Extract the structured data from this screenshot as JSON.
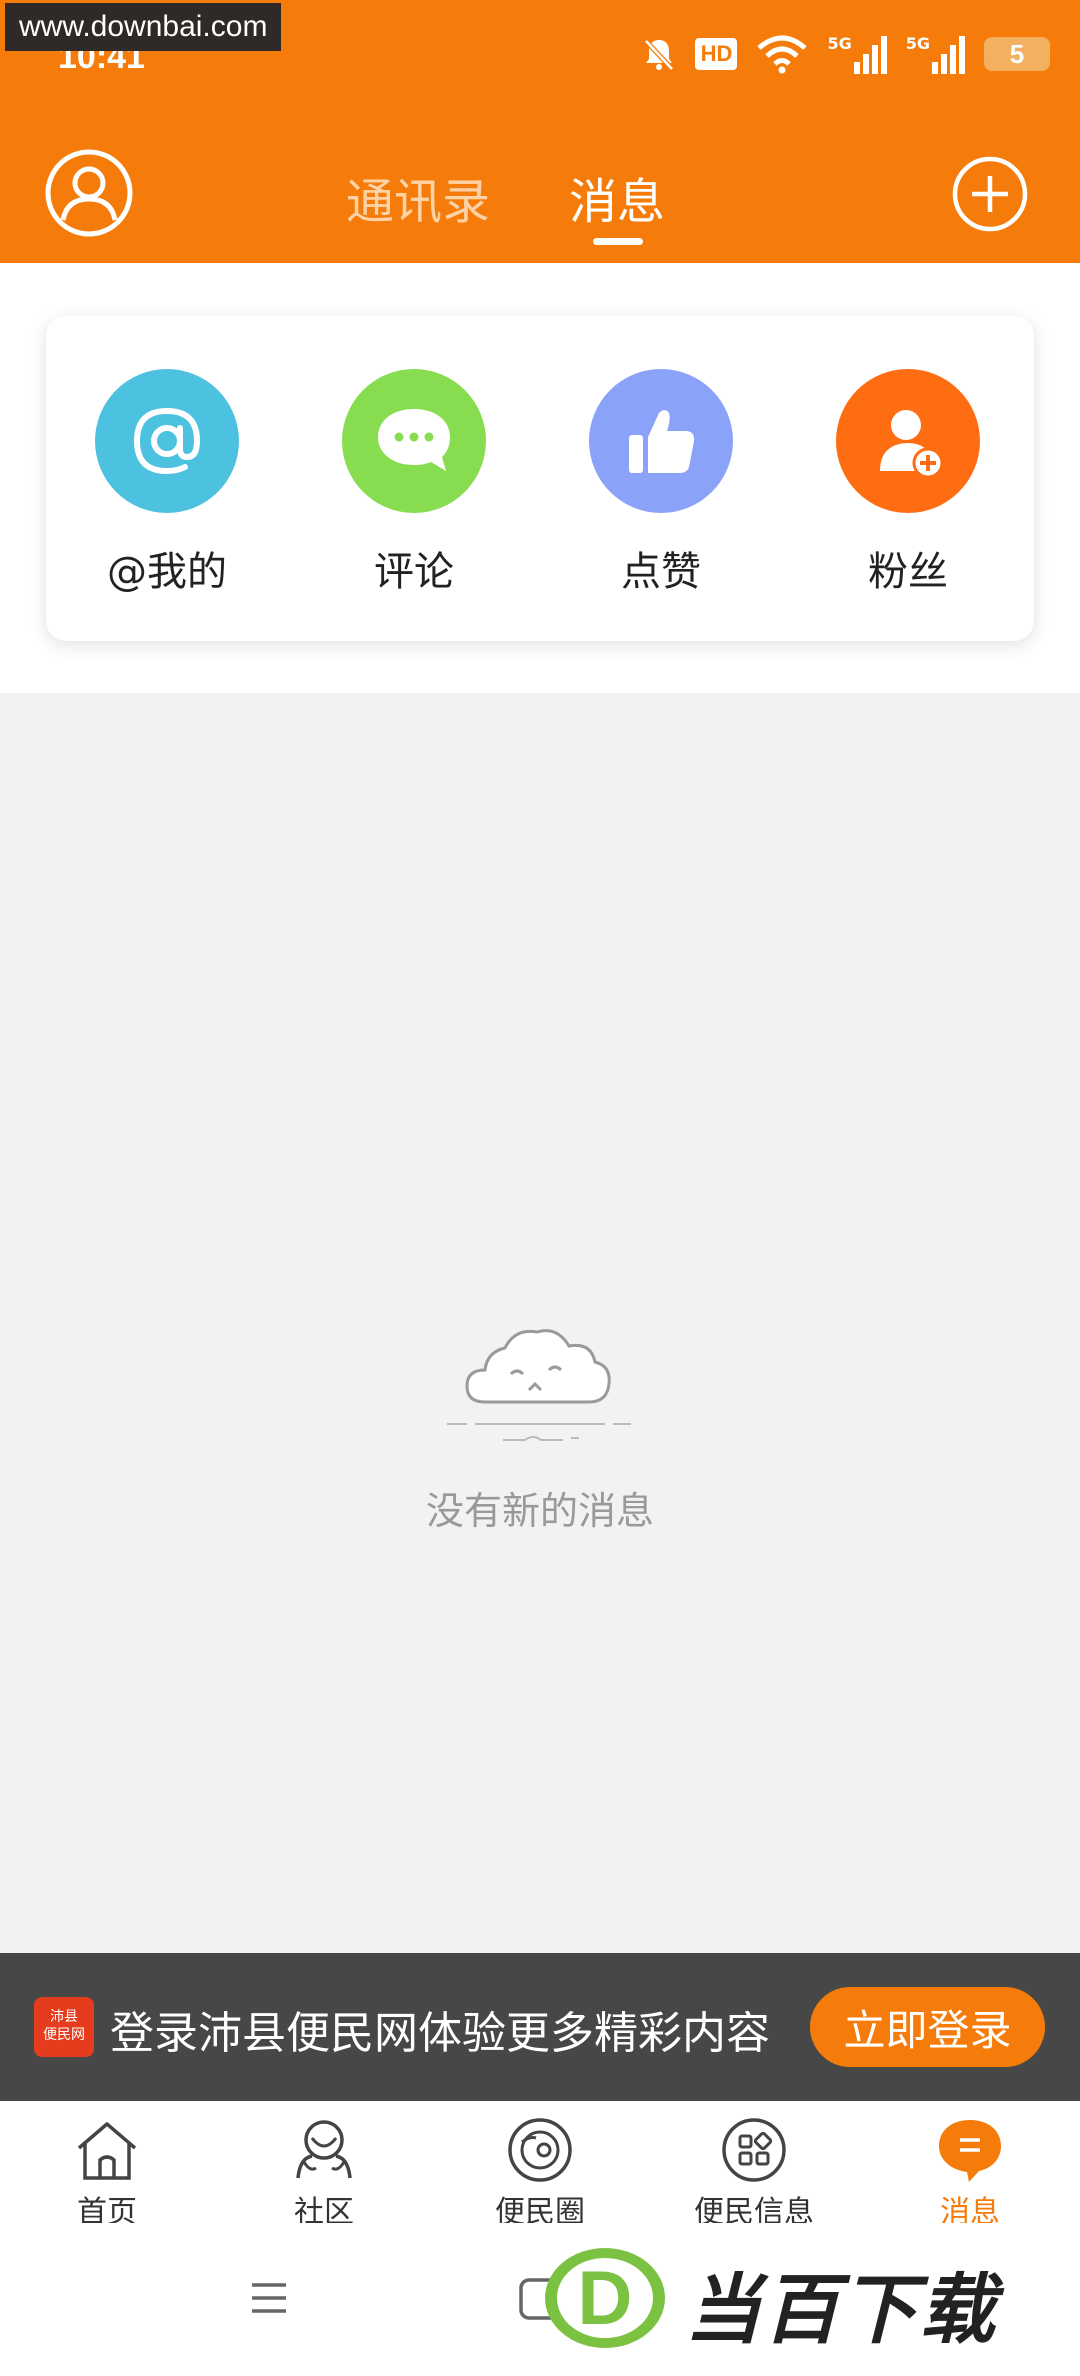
{
  "status_bar": {
    "watermark": "www.downbai.com",
    "time": "10:41",
    "hd_label": "HD",
    "network_1": "5G",
    "network_2": "5G",
    "battery": "5"
  },
  "header": {
    "tabs": [
      {
        "label": "通讯录",
        "active": false
      },
      {
        "label": "消息",
        "active": true
      }
    ]
  },
  "shortcuts": [
    {
      "label": "@我的",
      "icon": "at-icon",
      "color": "#4dc1e0"
    },
    {
      "label": "评论",
      "icon": "comment-icon",
      "color": "#87dd4f"
    },
    {
      "label": "点赞",
      "icon": "thumbs-up-icon",
      "color": "#8ba2f9"
    },
    {
      "label": "粉丝",
      "icon": "add-follower-icon",
      "color": "#fe6d12"
    }
  ],
  "empty_state": {
    "text": "没有新的消息"
  },
  "login_banner": {
    "logo_line1": "沛县",
    "logo_line2": "便民网",
    "text": "登录沛县便民网体验更多精彩内容",
    "button": "立即登录"
  },
  "bottom_nav": [
    {
      "label": "首页",
      "icon": "home-icon",
      "active": false
    },
    {
      "label": "社区",
      "icon": "community-icon",
      "active": false
    },
    {
      "label": "便民圈",
      "icon": "circle-icon",
      "active": false
    },
    {
      "label": "便民信息",
      "icon": "info-grid-icon",
      "active": false
    },
    {
      "label": "消息",
      "icon": "message-icon",
      "active": true
    }
  ],
  "watermark_br": {
    "letter": "D",
    "text": "当百下载"
  },
  "colors": {
    "brand": "#f57c0a",
    "banner_bg": "#474747"
  }
}
